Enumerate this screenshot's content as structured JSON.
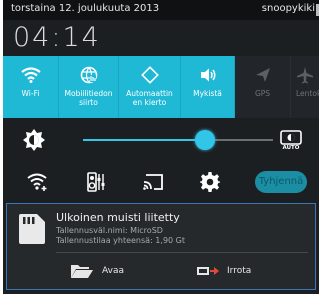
{
  "statusbar": {
    "date": "torstaina 12. joulukuuta 2013",
    "user": "snoopykiki"
  },
  "clock": "04:14",
  "quick_settings": [
    {
      "label": "Wi-Fi",
      "icon": "wifi-icon",
      "active": true
    },
    {
      "label": "Mobiilitiedon\nsiirto",
      "icon": "mobile-data-icon",
      "active": true
    },
    {
      "label": "Automaattin\nen kierto",
      "icon": "auto-rotate-icon",
      "active": true
    },
    {
      "label": "Mykistä",
      "icon": "volume-icon",
      "active": true
    },
    {
      "label": "GPS",
      "icon": "gps-icon",
      "active": false
    },
    {
      "label": "Lentok",
      "icon": "airplane-icon",
      "active": false
    }
  ],
  "brightness": {
    "level": 0.64,
    "auto_label": "AUTO"
  },
  "actions": {
    "clear_label": "Tyhjennä"
  },
  "notification": {
    "title": "Ulkoinen muisti liitetty",
    "line1": "Tallennusväl.nimi: MicroSD",
    "line2": "Tallennustilaa yhteensä: 1,90 Gt",
    "open_label": "Avaa",
    "eject_label": "Irrota"
  },
  "colors": {
    "accent": "#1fb9d6",
    "thumb": "#33c5e7",
    "background": "#1c1f22"
  }
}
